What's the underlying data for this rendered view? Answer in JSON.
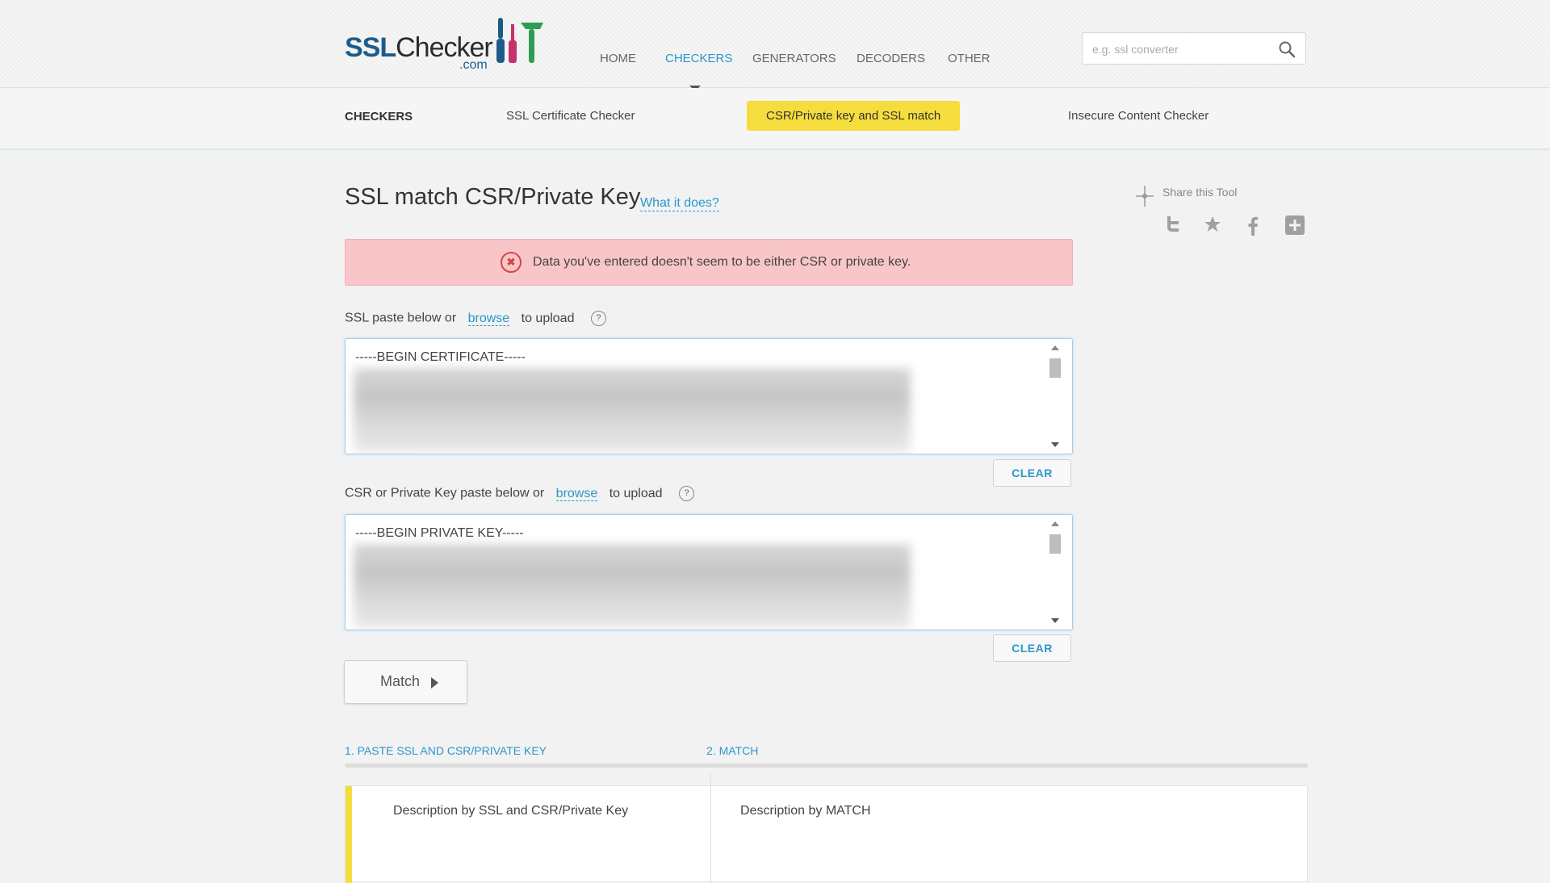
{
  "header": {
    "logo": {
      "ssl": "SSL",
      "checker": "Checker",
      "com": ".com"
    },
    "nav": [
      "HOME",
      "CHECKERS",
      "GENERATORS",
      "DECODERS",
      "OTHER"
    ],
    "active_nav": "CHECKERS",
    "search_placeholder": "e.g. ssl converter"
  },
  "subnav": {
    "title": "CHECKERS",
    "items": [
      "SSL Certificate Checker",
      "CSR/Private key and SSL match",
      "Insecure Content Checker"
    ],
    "active_item": "CSR/Private key and SSL match"
  },
  "main": {
    "title": "SSL match CSR/Private Key",
    "what_link": "What it does?",
    "alert": "Data you've entered doesn't seem to be either CSR or private key.",
    "ssl_field": {
      "prefix": "SSL paste below or",
      "browse": "browse",
      "suffix": "to upload",
      "first_line": "-----BEGIN CERTIFICATE-----"
    },
    "key_field": {
      "prefix": "CSR or Private Key paste below or",
      "browse": "browse",
      "suffix": "to upload",
      "first_line": "-----BEGIN PRIVATE KEY-----"
    },
    "clear_label": "CLEAR",
    "match_label": "Match",
    "steps": [
      "1. PASTE SSL AND CSR/PRIVATE KEY",
      "2. MATCH"
    ],
    "descriptions": [
      "Description by SSL and CSR/Private Key",
      "Description by MATCH"
    ]
  },
  "share": {
    "label": "Share this Tool",
    "icons": [
      "twitter-icon",
      "star-icon",
      "facebook-icon",
      "plus-icon"
    ]
  },
  "colors": {
    "accent_blue": "#2a97c9",
    "highlight_yellow": "#f5dd3d",
    "alert_bg": "#f8c6c9",
    "logo_blue": "#1d5c8a"
  }
}
